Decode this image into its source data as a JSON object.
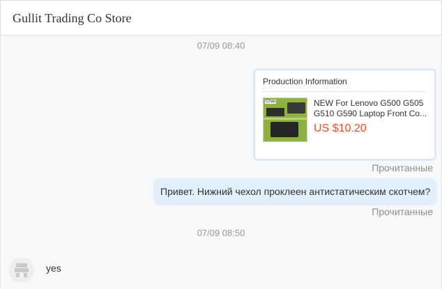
{
  "header": {
    "store_name": "Gullit Trading Co Store"
  },
  "messages": {
    "timestamp_1": "07/09 08:40",
    "product_card": {
      "title": "Production Information",
      "thumbnail_brand": "Chau",
      "product_name_line1": "NEW For Lenovo G500 G505",
      "product_name_line2": "G510 G590 Laptop Front Co...",
      "price": "US $10.20"
    },
    "read_status_1": "Прочитанные",
    "outgoing_text": "Привет. Нижний чехол проклеен антистатическим скотчем?",
    "read_status_2": "Прочитанные",
    "timestamp_2": "07/09 08:50",
    "incoming_text": "yes"
  },
  "colors": {
    "price": "#f0501e",
    "outgoing_bubble": "#e3eefb",
    "card_border": "#dbe8fb",
    "timestamp": "#999999"
  },
  "icons": {
    "avatar": "store-avatar-icon"
  }
}
